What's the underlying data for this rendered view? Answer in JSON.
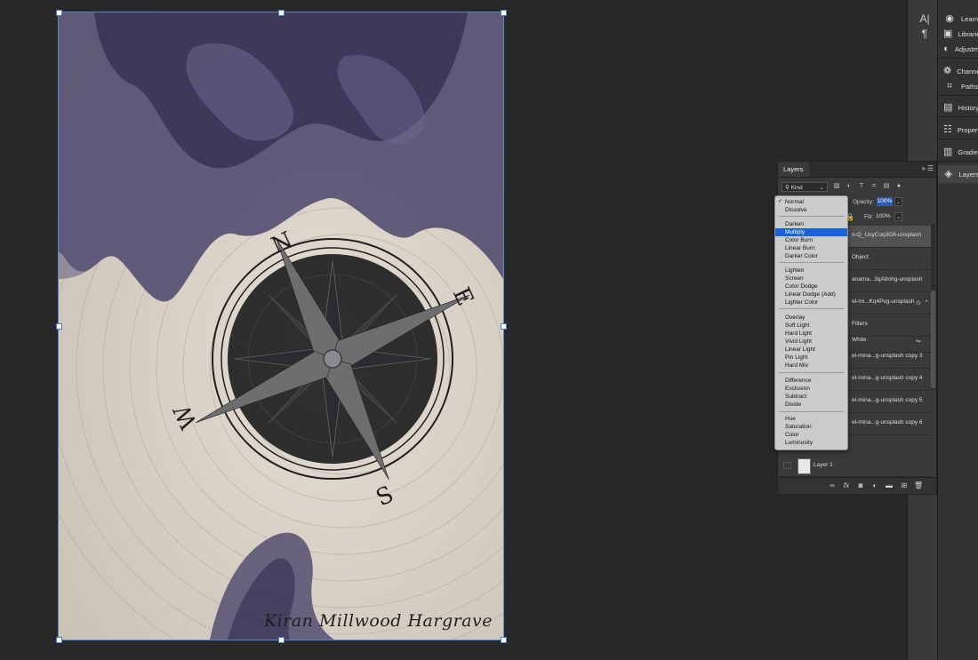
{
  "canvas": {
    "author_text": "Kiran Millwood Hargrave",
    "compass_letters": [
      "N",
      "E",
      "S",
      "W"
    ]
  },
  "dock_icons": [
    "character-icon",
    "paragraph-icon"
  ],
  "panel_list": [
    {
      "label": "Learn",
      "icon": "bulb-icon"
    },
    {
      "label": "Librarie",
      "icon": "library-icon"
    },
    {
      "label": "Adjustm",
      "icon": "adjustments-icon"
    },
    {
      "label": "Channe",
      "icon": "channels-icon"
    },
    {
      "label": "Paths",
      "icon": "paths-icon"
    },
    {
      "label": "History",
      "icon": "history-icon"
    },
    {
      "label": "Propert",
      "icon": "properties-icon"
    },
    {
      "label": "Gradien",
      "icon": "gradients-icon"
    },
    {
      "label": "Layers",
      "icon": "layers-icon"
    }
  ],
  "layers_panel": {
    "tab_label": "Layers",
    "kind_filter": "Kind",
    "opacity_label": "Opacity:",
    "opacity_value": "100%",
    "fill_label": "Fill:",
    "fill_value": "100%",
    "rows": [
      "n-Q_UsyCoq3G8-unsplash",
      "Object",
      "anama...3qA8ohg-unsplash",
      "el-mi...Kq4Pvg-unsplash",
      "Filters",
      "White",
      "el-mina...g-unsplash copy 3",
      "el-mina...g-unsplash copy 4",
      "el-mina...g-unsplash copy 5",
      "el-mina...g-unsplash copy 6"
    ],
    "bottom_layer": "Layer 1"
  },
  "blend_menu": {
    "selected": "Normal",
    "highlighted": "Multiply",
    "groups": [
      [
        "Normal",
        "Dissolve"
      ],
      [
        "Darken",
        "Multiply",
        "Color Burn",
        "Linear Burn",
        "Darker Color"
      ],
      [
        "Lighten",
        "Screen",
        "Color Dodge",
        "Linear Dodge (Add)",
        "Lighter Color"
      ],
      [
        "Overlay",
        "Soft Light",
        "Hard Light",
        "Vivid Light",
        "Linear Light",
        "Pin Light",
        "Hard Mix"
      ],
      [
        "Difference",
        "Exclusion",
        "Subtract",
        "Divide"
      ],
      [
        "Hue",
        "Saturation",
        "Color",
        "Luminosity"
      ]
    ]
  },
  "colors": {
    "app_bg": "#282828",
    "panel_bg": "#3a3a3a",
    "menu_bg": "#cbcbcb",
    "highlight": "#1b62d6",
    "ink_purple": "#3e3a5c",
    "paper": "#d9d2c8"
  }
}
